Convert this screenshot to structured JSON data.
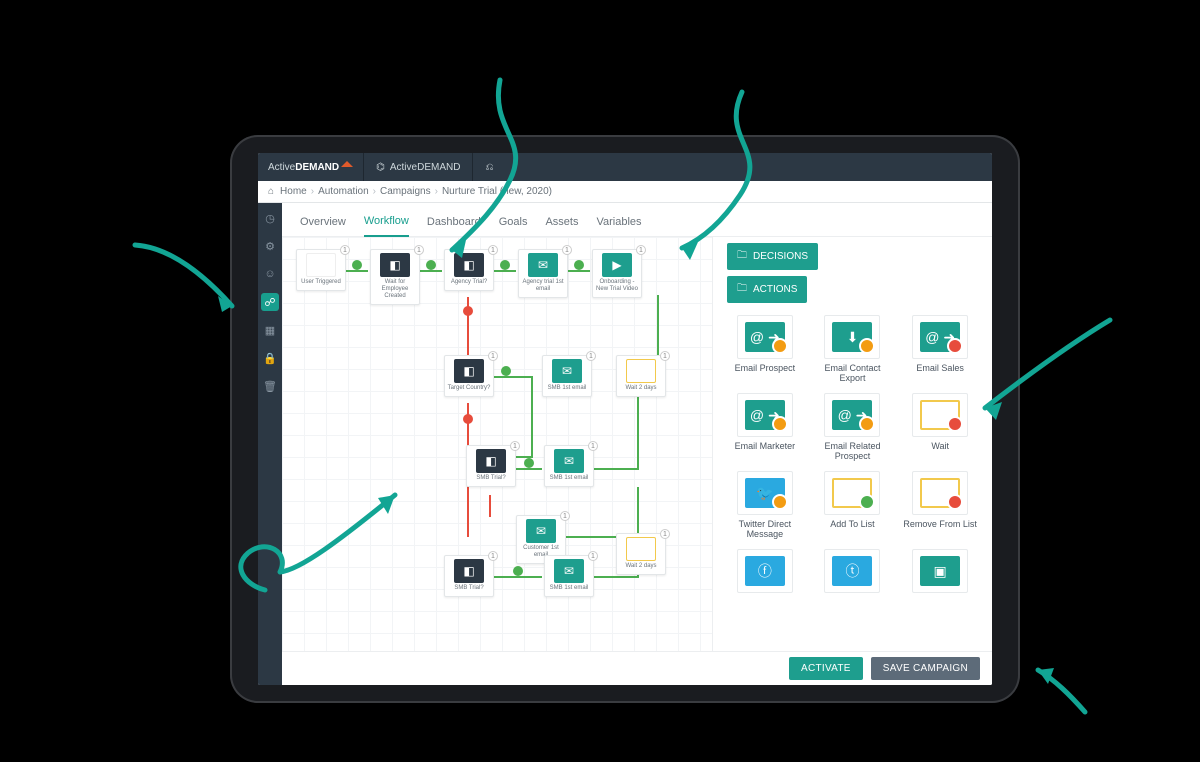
{
  "brand": {
    "left": "Active",
    "right": "DEMAND"
  },
  "topbar": {
    "account_label": "ActiveDEMAND"
  },
  "breadcrumb": {
    "home": "Home",
    "l1": "Automation",
    "l2": "Campaigns",
    "l3": "Nurture Trial (new, 2020)"
  },
  "tabs": {
    "overview": "Overview",
    "workflow": "Workflow",
    "dashboard": "Dashboard",
    "goals": "Goals",
    "assets": "Assets",
    "variables": "Variables"
  },
  "palette": {
    "decisions_btn": "DECISIONS",
    "actions_btn": "ACTIONS",
    "cards": {
      "email_prospect": "Email Prospect",
      "email_contact_export": "Email Contact Export",
      "email_sales": "Email Sales",
      "email_marketer": "Email Marketer",
      "email_related_prospect": "Email Related Prospect",
      "wait": "Wait",
      "twitter_dm": "Twitter Direct Message",
      "add_to_list": "Add To List",
      "remove_from_list": "Remove From List"
    }
  },
  "nodes": {
    "start": "User Triggered",
    "wait_emp": "Wait for Employee Created",
    "agency_trial": "Agency Trial?",
    "agency_mail": "Agency trial 1st email",
    "onboard": "Onboarding - New Trial Video",
    "target_country": "Target Country?",
    "smb_mail1": "SMB 1st email",
    "smb_trial": "SMB Trial?",
    "wait2": "Wait 2 days",
    "cust_mail": "Customer 1st email",
    "smb_mail2": "SMB 1st email",
    "wait3": "Wait 2 days"
  },
  "footer": {
    "activate": "ACTIVATE",
    "save": "SAVE CAMPAIGN"
  }
}
